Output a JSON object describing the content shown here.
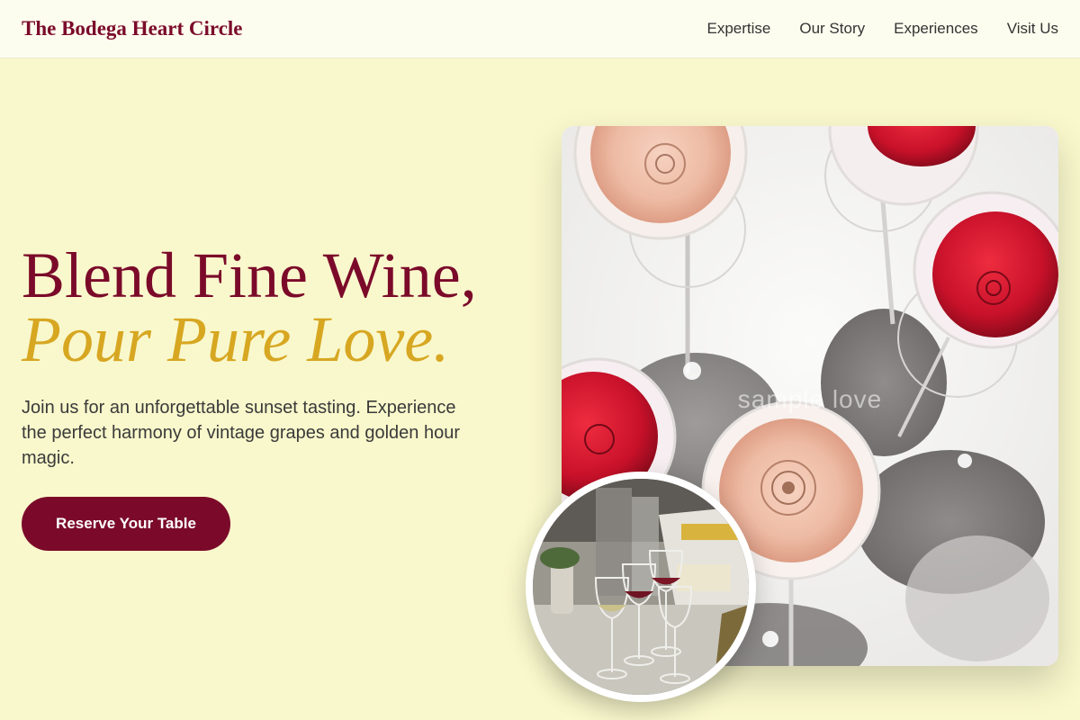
{
  "brand": {
    "name": "The Bodega Heart Circle"
  },
  "nav": {
    "links": [
      "Expertise",
      "Our Story",
      "Experiences",
      "Visit Us"
    ]
  },
  "hero": {
    "headline_line1": "Blend Fine Wine,",
    "headline_line2": "Pour Pure Love.",
    "subtext": "Join us for an unforgettable sunset tasting. Experience the perfect harmony of vintage grapes and golden hour magic.",
    "cta_label": "Reserve Your Table"
  },
  "images": {
    "main_photo_watermark": "sample love"
  },
  "colors": {
    "background": "#f9f8cc",
    "brand": "#7b0a2a",
    "accent": "#d7a722"
  }
}
